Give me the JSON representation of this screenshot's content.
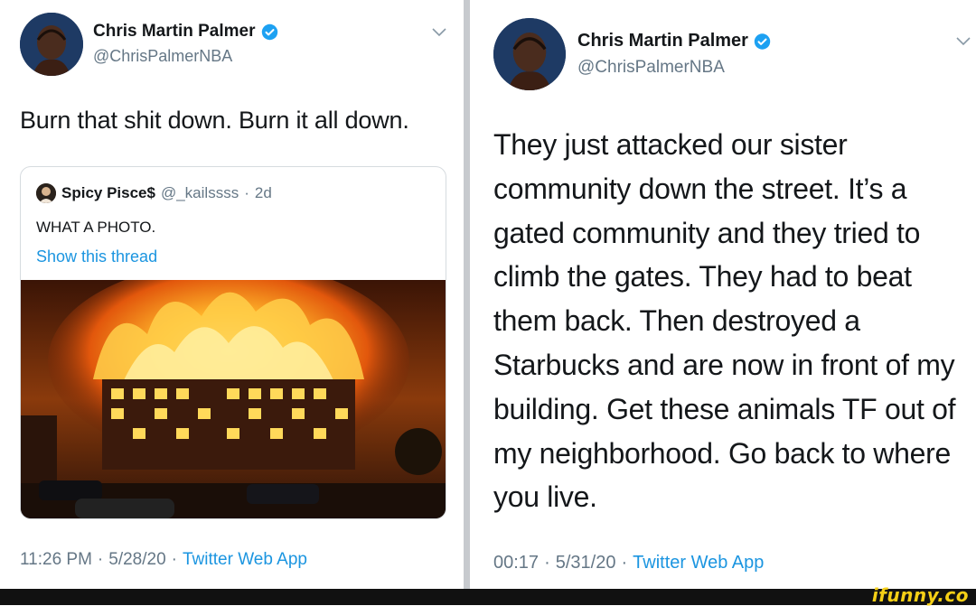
{
  "left_tweet": {
    "author": {
      "name": "Chris Martin Palmer",
      "handle": "@ChrisPalmerNBA",
      "verified": true
    },
    "text": "Burn that shit down. Burn it all down.",
    "quoted_tweet": {
      "author_name": "Spicy Pisce$",
      "handle": "@_kailssss",
      "age": "2d",
      "text": "WHAT A PHOTO.",
      "thread_link": "Show this thread"
    },
    "time": "11:26 PM",
    "date": "5/28/20",
    "source": "Twitter Web App"
  },
  "right_tweet": {
    "author": {
      "name": "Chris Martin Palmer",
      "handle": "@ChrisPalmerNBA",
      "verified": true
    },
    "text": "They just attacked our sister community down the street. It’s a gated community and they tried to climb the gates. They had to beat them back. Then destroyed a Starbucks and are now in front of my building. Get these animals TF out of my neighborhood. Go back to where you live.",
    "time": "00:17",
    "date": "5/31/20",
    "source": "Twitter Web App"
  },
  "watermark": "ifunny.co",
  "colors": {
    "link": "#1b95e0",
    "secondary_text": "#657786",
    "verified_badge": "#1da1f2"
  },
  "icons": [
    "verified-badge-icon",
    "chevron-down-icon"
  ]
}
